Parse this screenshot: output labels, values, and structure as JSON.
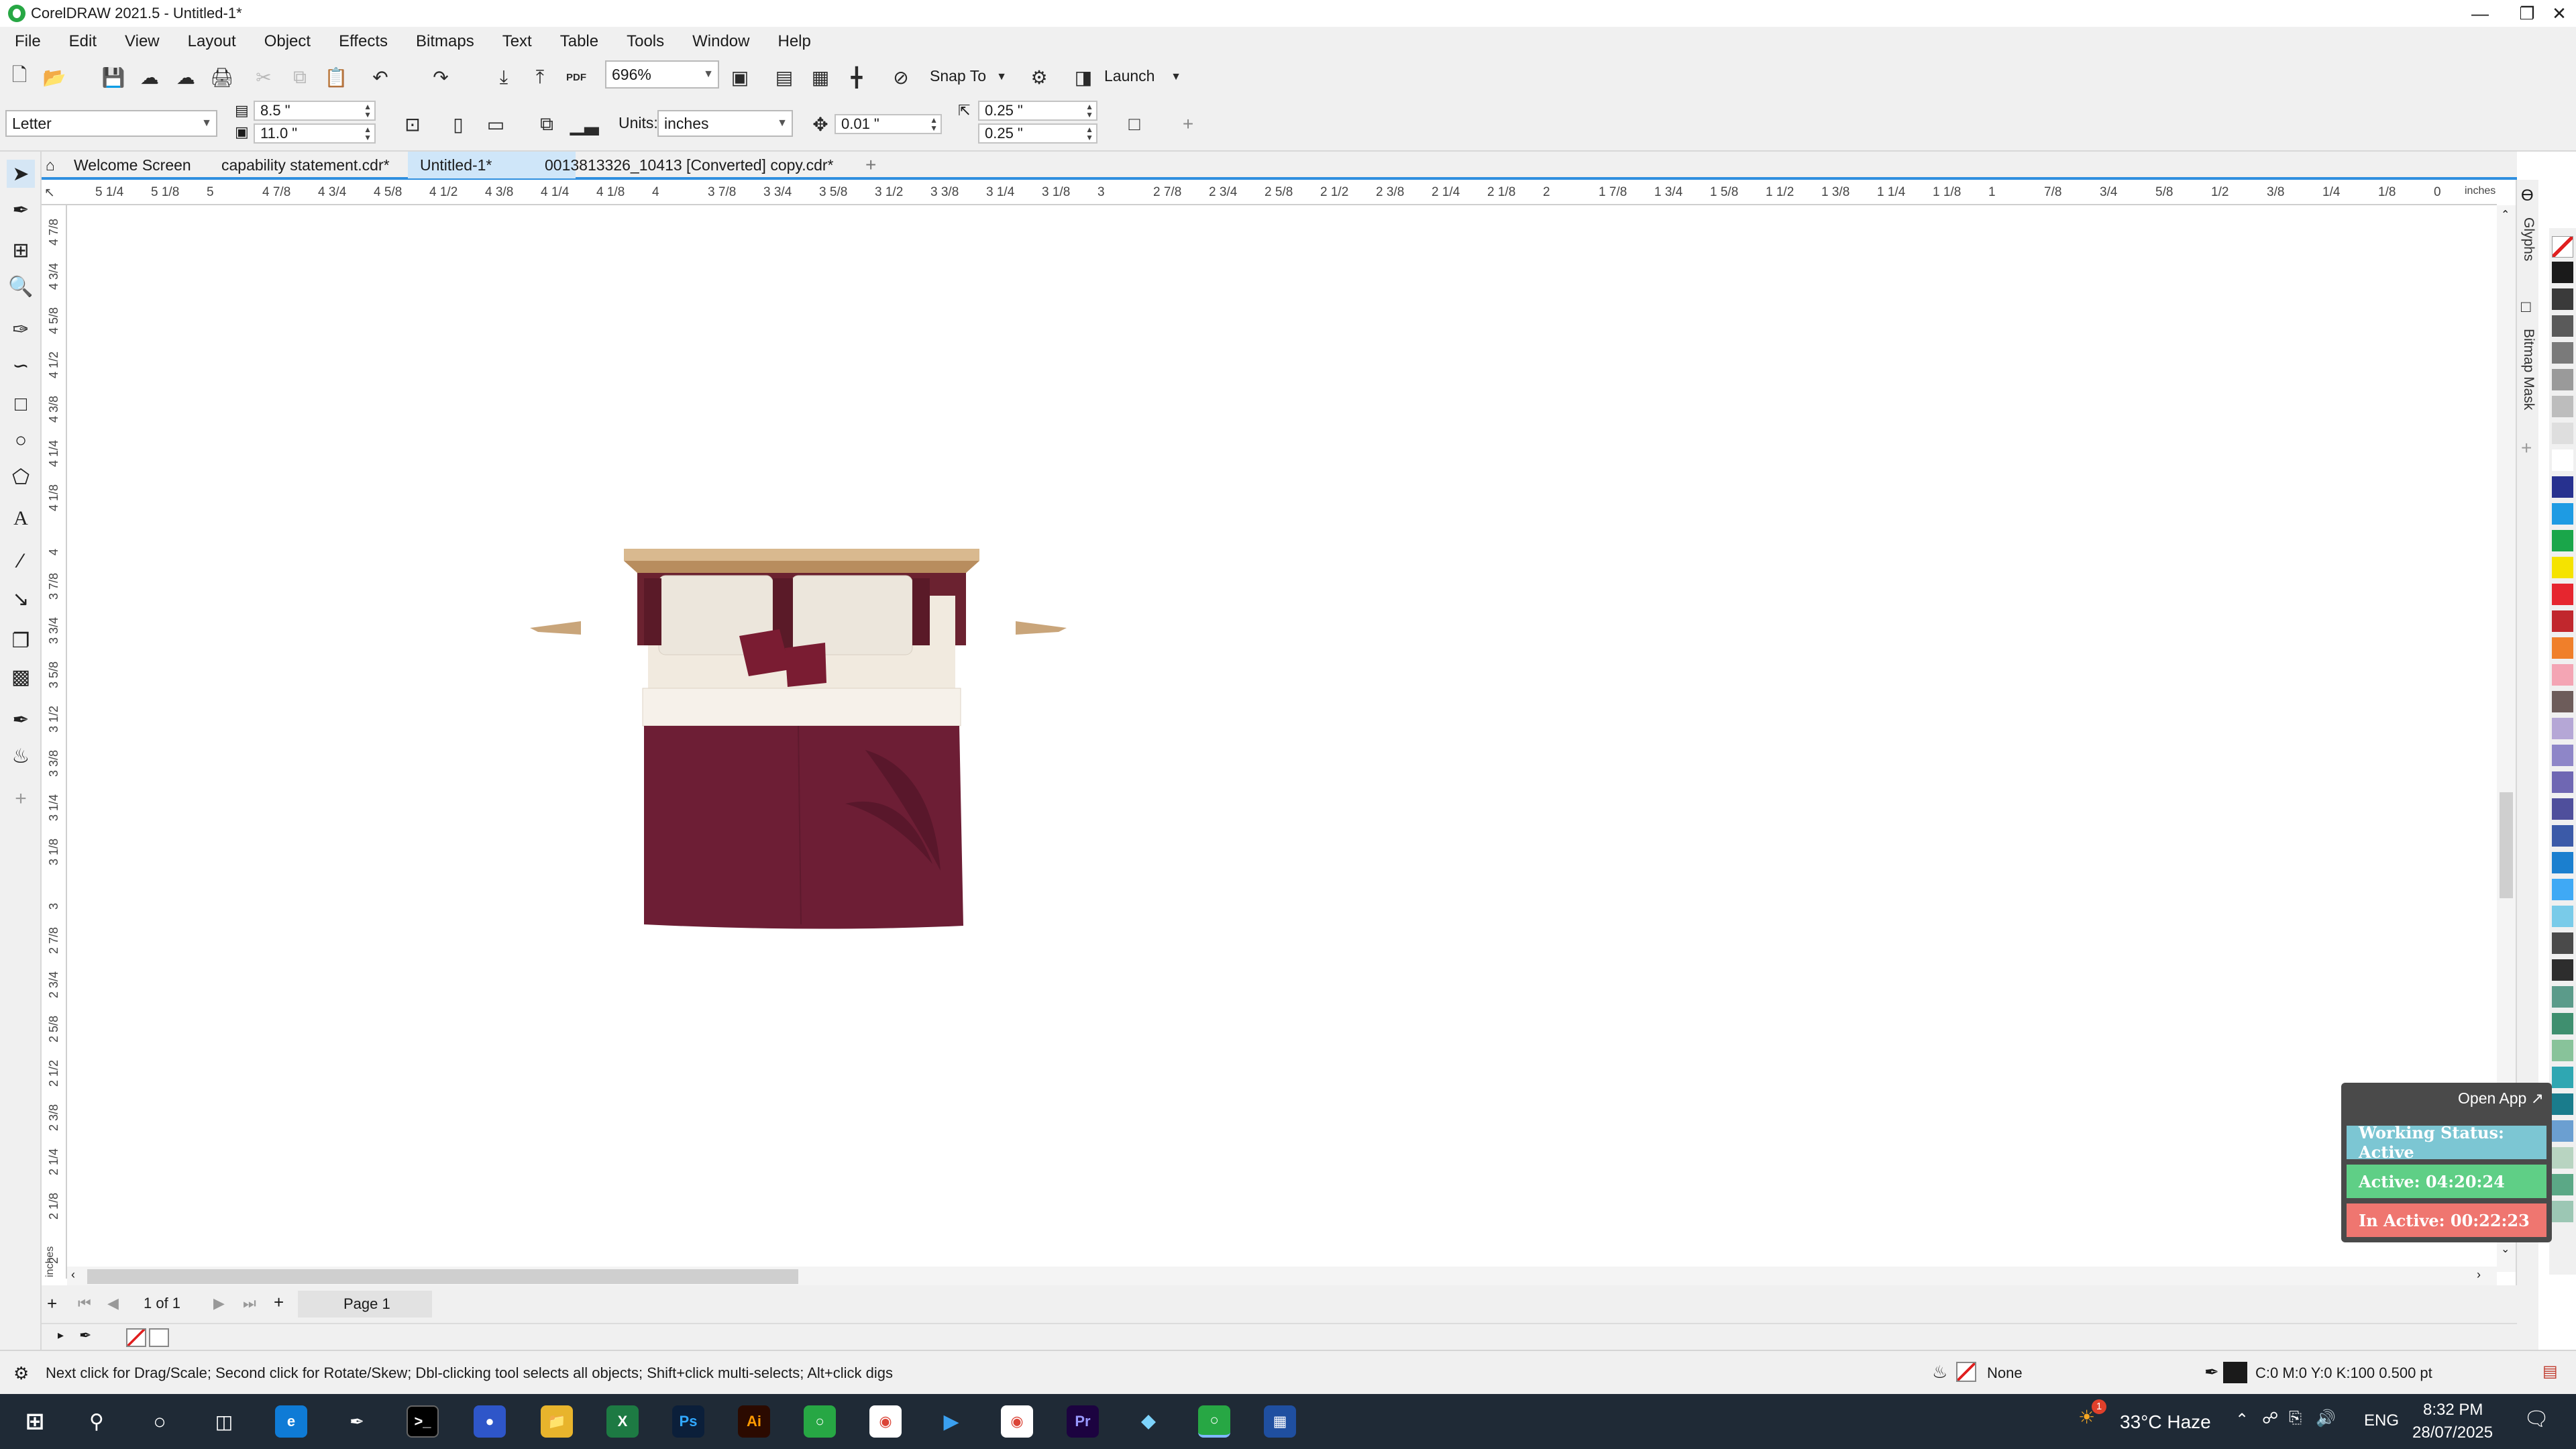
{
  "window": {
    "title": "CorelDRAW 2021.5 - Untitled-1*",
    "controls": [
      "minimize-icon",
      "maximize-icon",
      "close-icon"
    ]
  },
  "menu": [
    "File",
    "Edit",
    "View",
    "Layout",
    "Object",
    "Effects",
    "Bitmaps",
    "Text",
    "Table",
    "Tools",
    "Window",
    "Help"
  ],
  "toolbar": {
    "zoom": "696%",
    "snap_label": "Snap To",
    "launch_label": "Launch",
    "pdf_label": "PDF"
  },
  "propbar": {
    "page_size": "Letter",
    "width": "8.5 \"",
    "height": "11.0 \"",
    "units_label": "Units:",
    "units_value": "inches",
    "nudge": "0.01 \"",
    "dup_x": "0.25 \"",
    "dup_y": "0.25 \""
  },
  "tabs": [
    {
      "label": "Welcome Screen",
      "active": false
    },
    {
      "label": "capability statement.cdr*",
      "active": false
    },
    {
      "label": "Untitled-1*",
      "active": true
    },
    {
      "label": "0013813326_10413 [Converted] copy.cdr*",
      "active": false
    }
  ],
  "ruler": {
    "unit": "inches",
    "h_ticks": [
      "5 1/4",
      "5 1/8",
      "5",
      "4 7/8",
      "4 3/4",
      "4 5/8",
      "4 1/2",
      "4 3/8",
      "4 1/4",
      "4 1/8",
      "4",
      "3 7/8",
      "3 3/4",
      "3 5/8",
      "3 1/2",
      "3 3/8",
      "3 1/4",
      "3 1/8",
      "3",
      "2 7/8",
      "2 3/4",
      "2 5/8",
      "2 1/2",
      "2 3/8",
      "2 1/4",
      "2 1/8",
      "2",
      "1 7/8",
      "1 3/4",
      "1 5/8",
      "1 1/2",
      "1 3/8",
      "1 1/4",
      "1 1/8",
      "1",
      "7/8",
      "3/4",
      "5/8",
      "1/2",
      "3/8",
      "1/4",
      "1/8",
      "0"
    ],
    "v_ticks": [
      "4 7/8",
      "4 3/4",
      "4 5/8",
      "4 1/2",
      "4 3/8",
      "4 1/4",
      "4 1/8",
      "4",
      "3 7/8",
      "3 3/4",
      "3 5/8",
      "3 1/2",
      "3 3/8",
      "3 1/4",
      "3 1/8",
      "3",
      "2 7/8",
      "2 3/4",
      "2 5/8",
      "2 1/2",
      "2 3/8",
      "2 1/4",
      "2 1/8",
      "2"
    ]
  },
  "dockers": [
    "Glyphs",
    "Bitmap Mask"
  ],
  "pagenav": {
    "page_count": "1 of 1",
    "page_tab": "Page 1"
  },
  "status": {
    "hint": "Next click for Drag/Scale; Second click for Rotate/Skew; Dbl-clicking tool selects all objects; Shift+click multi-selects; Alt+click digs",
    "fill": "None",
    "outline": "C:0 M:0 Y:0 K:100  0.500 pt"
  },
  "tracker": {
    "open_app": "Open App ↗",
    "working_status": "Working Status: Active",
    "active": "Active: 04:20:24",
    "inactive": "In Active: 00:22:23",
    "colors": {
      "status": "#7cc6d3",
      "active": "#5fcf86",
      "inactive": "#ef7670"
    }
  },
  "taskbar": {
    "weather": "33°C  Haze",
    "lang": "ENG",
    "time": "8:32 PM",
    "date": "28/07/2025",
    "weather_badge": "1"
  },
  "palette_colors": [
    "#1a1a1a",
    "#3a3a3a",
    "#5a5a5a",
    "#7a7a7a",
    "#9a9a9a",
    "#bdbdbd",
    "#dedede",
    "#ffffff",
    "#27318f",
    "#1e9be3",
    "#1aa64a",
    "#f5e300",
    "#e6262f",
    "#c1272d",
    "#f07f2a",
    "#f4a5b4",
    "#6d5c5a",
    "#b5a7d6",
    "#8e86c8",
    "#6f67b3",
    "#4f4f9c",
    "#3b5aa8",
    "#1b7fcf",
    "#3fa9f5",
    "#79cbe9",
    "#4a4a4a",
    "#2d2d2d",
    "#5b9b8a",
    "#3f8f6f",
    "#88c39a",
    "#2fa7b2",
    "#1a7c8c",
    "#6b9fd1",
    "#b8d4c1",
    "#5ba886",
    "#9cc7b4"
  ],
  "colors": {
    "accent": "#2f8fdf",
    "bed_headboard": "#c9a57a",
    "bed_blanket": "#6d1e35",
    "pillow": "#efe8df"
  }
}
